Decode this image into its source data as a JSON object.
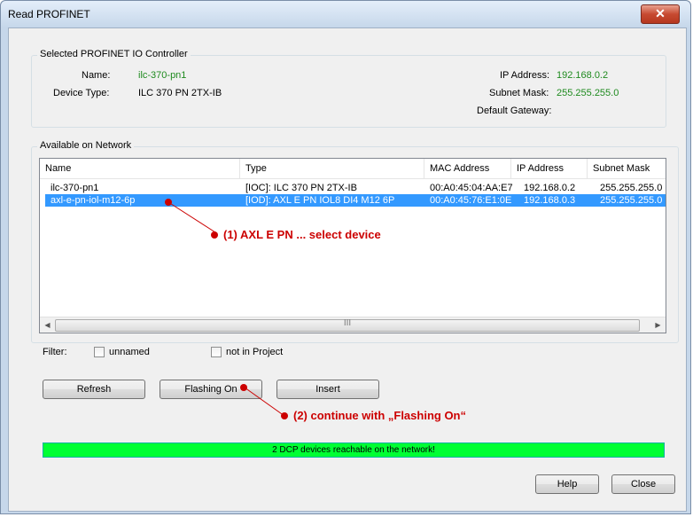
{
  "window": {
    "title": "Read PROFINET",
    "close_glyph": "✕"
  },
  "controller": {
    "group_title": "Selected PROFINET IO Controller",
    "name_label": "Name:",
    "name_value": "ilc-370-pn1",
    "device_type_label": "Device Type:",
    "device_type_value": "ILC 370 PN 2TX-IB",
    "ip_label": "IP Address:",
    "ip_value": "192.168.0.2",
    "subnet_label": "Subnet Mask:",
    "subnet_value": "255.255.255.0",
    "gateway_label": "Default Gateway:",
    "gateway_value": ""
  },
  "network": {
    "group_title": "Available on Network",
    "columns": [
      "Name",
      "Type",
      "MAC Address",
      "IP Address",
      "Subnet Mask"
    ],
    "rows": [
      {
        "name": "ilc-370-pn1",
        "type": "[IOC]: ILC 370 PN 2TX-IB",
        "mac": "00:A0:45:04:AA:E7",
        "ip": "192.168.0.2",
        "subnet": "255.255.255.0",
        "selected": false
      },
      {
        "name": "axl-e-pn-iol-m12-6p",
        "type": "[IOD]: AXL E PN IOL8 DI4 M12 6P",
        "mac": "00:A0:45:76:E1:0E",
        "ip": "192.168.0.3",
        "subnet": "255.255.255.0",
        "selected": true
      }
    ],
    "scroll_left": "◀",
    "scroll_right": "▶",
    "scroll_grip": "III"
  },
  "filter": {
    "label": "Filter:",
    "unnamed_label": "unnamed",
    "not_in_project_label": "not in Project"
  },
  "buttons": {
    "refresh": "Refresh",
    "flashing_on": "Flashing On",
    "insert": "Insert",
    "help": "Help",
    "close": "Close"
  },
  "status": {
    "text": "2 DCP devices reachable on the network!",
    "color": "#00ff33"
  },
  "annotations": {
    "step1": "(1) AXL E PN ... select device",
    "step2": "(2) continue with „Flashing On“",
    "color": "#cc0000"
  }
}
